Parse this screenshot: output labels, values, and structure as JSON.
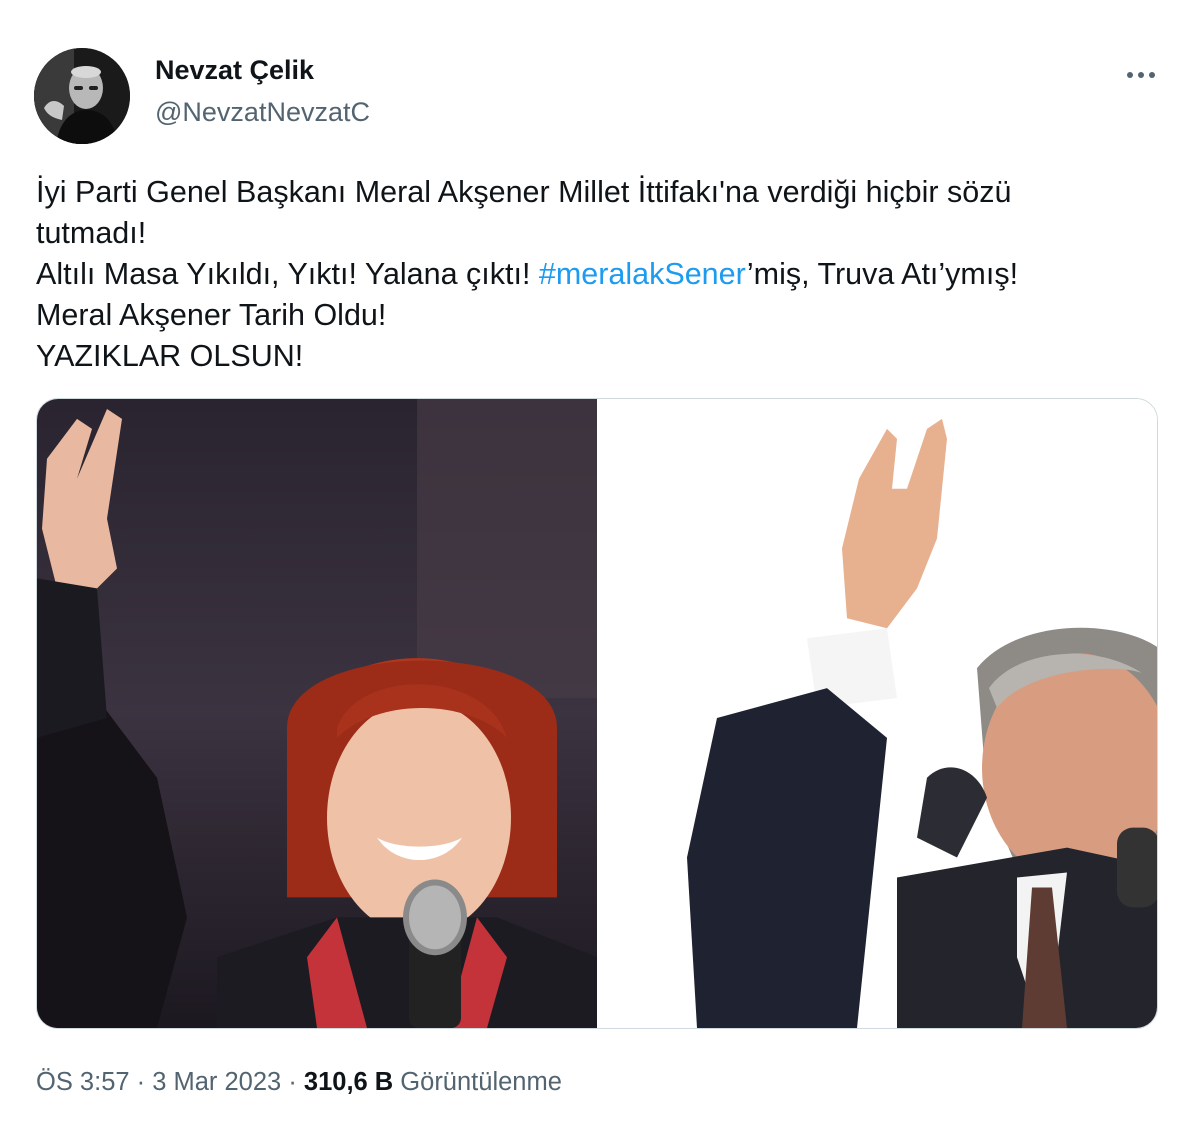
{
  "author": {
    "display_name": "Nevzat Çelik",
    "handle": "@NevzatNevzatC"
  },
  "more_icon": "more-horizontal-icon",
  "tweet": {
    "line1": "İyi Parti Genel Başkanı Meral Akşener Millet İttifakı'na verdiği hiçbir sözü",
    "line2": "tutmadı!",
    "line3_before": "Altılı Masa Yıkıldı, Yıktı! Yalana çıktı! ",
    "line3_hashtag": "#meralakSener",
    "line3_after": "’miş, Truva Atı’ymış!",
    "line4": "Meral Akşener Tarih Oldu!",
    "line5": "YAZIKLAR OLSUN!"
  },
  "meta": {
    "time": "ÖS 3:57",
    "separator1": " · ",
    "date": "3 Mar 2023",
    "separator2": " · ",
    "views_count": "310,6 B",
    "views_label": " Görüntülenme"
  },
  "colors": {
    "text": "#0f1419",
    "secondary": "#536471",
    "link": "#1d9bf0",
    "border": "#cfd9de"
  }
}
